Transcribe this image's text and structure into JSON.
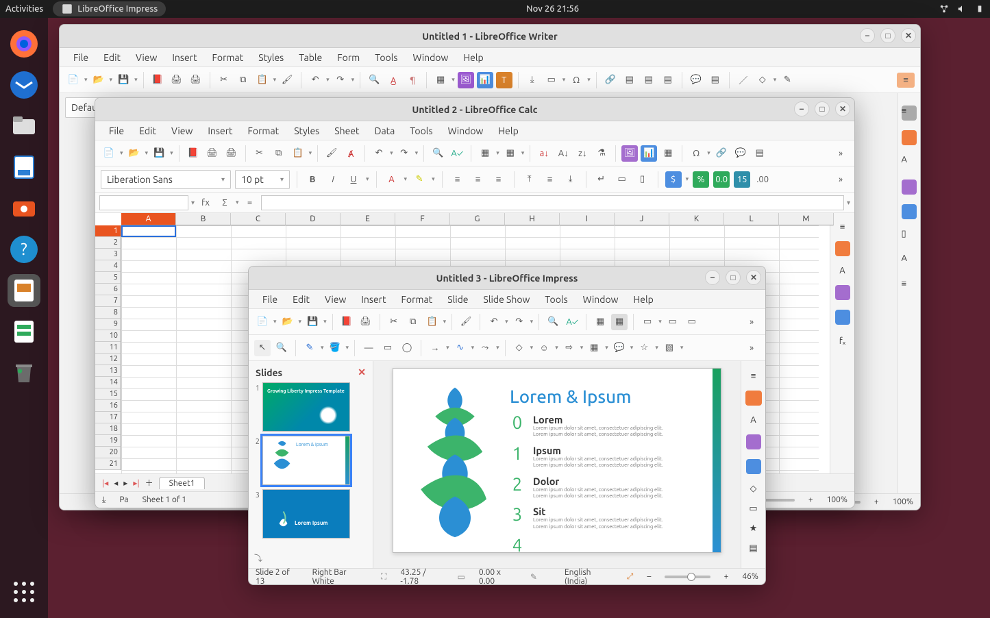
{
  "panel": {
    "activities": "Activities",
    "active_app": "LibreOffice Impress",
    "clock": "Nov 26  21:56"
  },
  "dock": {
    "items": [
      "firefox",
      "thunderbird",
      "files",
      "writer",
      "software",
      "help",
      "impress",
      "calc",
      "trash"
    ]
  },
  "writer": {
    "title": "Untitled 1 - LibreOffice Writer",
    "menu": [
      "File",
      "Edit",
      "View",
      "Insert",
      "Format",
      "Styles",
      "Table",
      "Form",
      "Tools",
      "Window",
      "Help"
    ],
    "paragraph_style": "Defau",
    "zoom": "100%"
  },
  "calc": {
    "title": "Untitled 2 - LibreOffice Calc",
    "menu": [
      "File",
      "Edit",
      "View",
      "Insert",
      "Format",
      "Styles",
      "Sheet",
      "Data",
      "Tools",
      "Window",
      "Help"
    ],
    "font_name": "Liberation Sans",
    "font_size": "10 pt",
    "columns": [
      "A",
      "B",
      "C",
      "D",
      "E",
      "F",
      "G",
      "H",
      "I",
      "J",
      "K",
      "L",
      "M"
    ],
    "rows": [
      1,
      2,
      3,
      4,
      5,
      6,
      7,
      8,
      9,
      10,
      11,
      12,
      13,
      14,
      15,
      16,
      17,
      18,
      19,
      20,
      21
    ],
    "active_cell": "A1",
    "sheet_tab": "Sheet1",
    "status_sheet": "Sheet 1 of 1",
    "status_prefix": "Pa",
    "zoom": "100%"
  },
  "impress": {
    "title": "Untitled 3 - LibreOffice Impress",
    "menu": [
      "File",
      "Edit",
      "View",
      "Insert",
      "Format",
      "Slide",
      "Slide Show",
      "Tools",
      "Window",
      "Help"
    ],
    "slides_label": "Slides",
    "thumbs": [
      {
        "n": 1,
        "caption": "Growing Liberty Impress Template"
      },
      {
        "n": 2,
        "caption": "Lorem & Ipsum"
      },
      {
        "n": 3,
        "caption": "Lorem Ipsum"
      }
    ],
    "slide": {
      "title": "Lorem & Ipsum",
      "bullets": [
        {
          "num": "0",
          "head": "Lorem",
          "sub": "Lorem ipsum dolor sit amet, consectetuer adipiscing elit. Lorem ipsum dolor sit amet, consectetuer adipiscing elit."
        },
        {
          "num": "1",
          "head": "Ipsum",
          "sub": "Lorem ipsum dolor sit amet, consectetuer adipiscing elit. Lorem ipsum dolor sit amet, consectetuer adipiscing elit."
        },
        {
          "num": "2",
          "head": "Dolor",
          "sub": "Lorem ipsum dolor sit amet, consectetuer adipiscing elit. Lorem ipsum dolor sit amet, consectetuer adipiscing elit."
        },
        {
          "num": "3",
          "head": "Sit",
          "sub": "Lorem ipsum dolor sit amet, consectetuer adipiscing elit. Lorem ipsum dolor sit amet, consectetuer adipiscing elit."
        },
        {
          "num": "4",
          "head": "",
          "sub": ""
        }
      ]
    },
    "status": {
      "slide_of": "Slide 2 of 13",
      "layout": "Right Bar White",
      "pos": "43.25 / -1.78",
      "size": "0.00 x 0.00",
      "lang": "English (India)",
      "zoom": "46%"
    }
  }
}
